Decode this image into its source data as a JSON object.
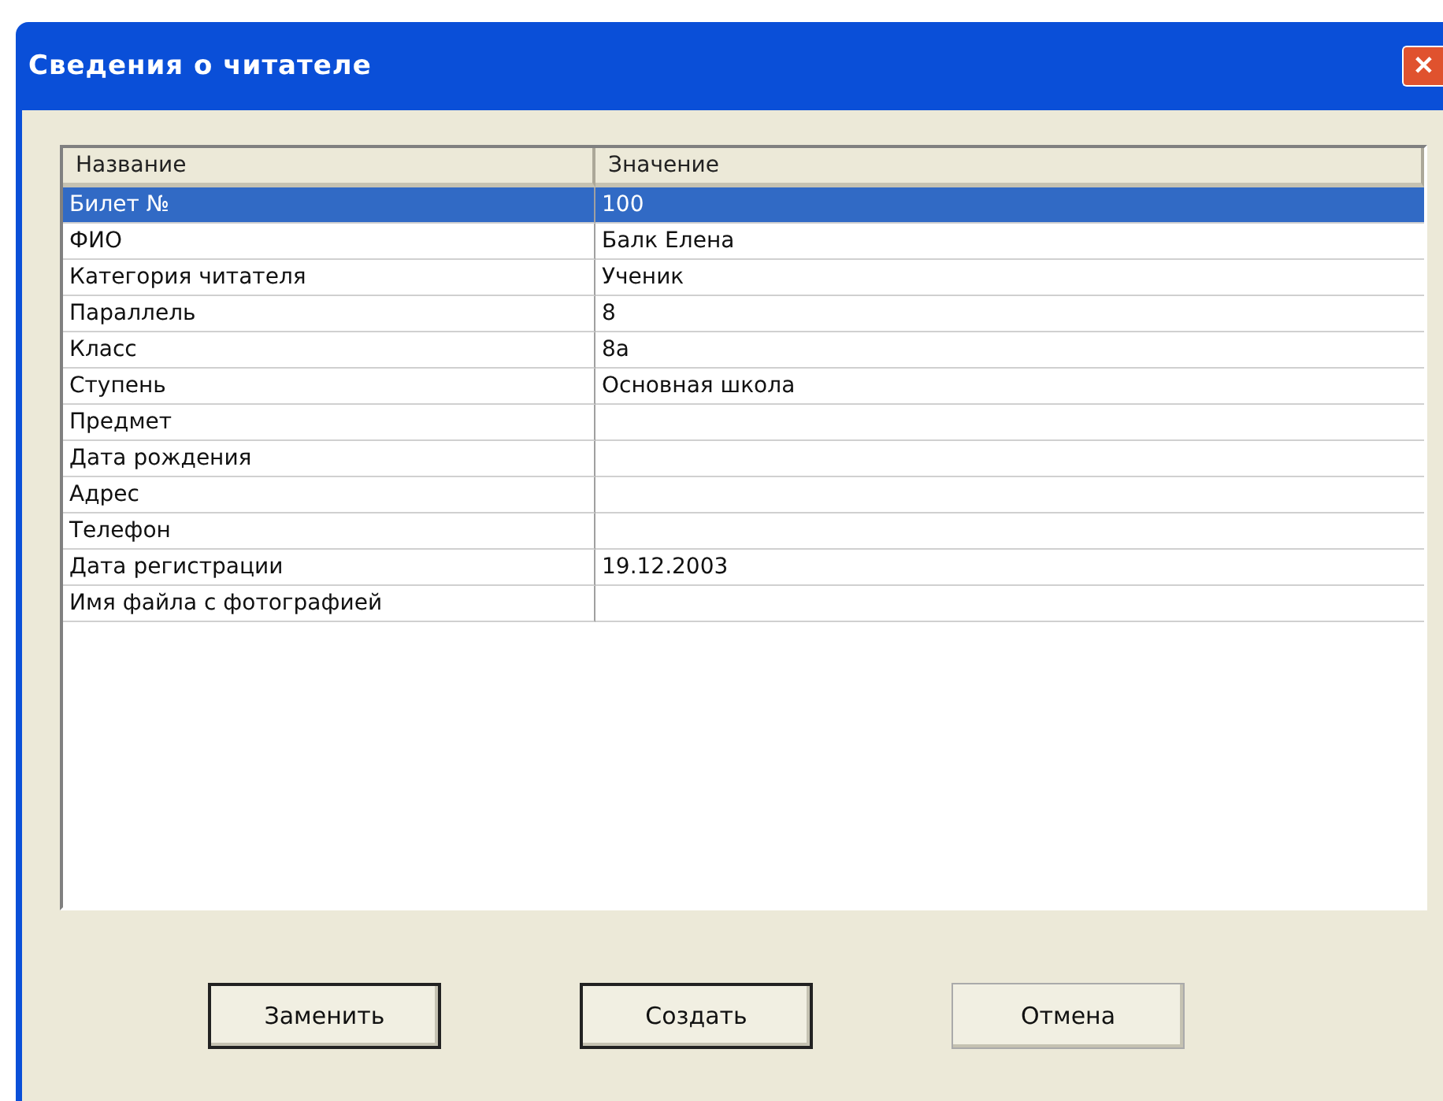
{
  "window": {
    "title": "Сведения о читателе",
    "close": "✕"
  },
  "table": {
    "columns": [
      "Название",
      "Значение"
    ],
    "rows": [
      {
        "name": "Билет №",
        "value": "100",
        "selected": true
      },
      {
        "name": "ФИО",
        "value": "Балк Елена",
        "selected": false
      },
      {
        "name": "Категория читателя",
        "value": "Ученик",
        "selected": false
      },
      {
        "name": "Параллель",
        "value": "8",
        "selected": false
      },
      {
        "name": "Класс",
        "value": "8а",
        "selected": false
      },
      {
        "name": "Ступень",
        "value": "Основная школа",
        "selected": false
      },
      {
        "name": "Предмет",
        "value": "",
        "selected": false
      },
      {
        "name": "Дата рождения",
        "value": "",
        "selected": false
      },
      {
        "name": "Адрес",
        "value": "",
        "selected": false
      },
      {
        "name": "Телефон",
        "value": "",
        "selected": false
      },
      {
        "name": "Дата регистрации",
        "value": "19.12.2003",
        "selected": false
      },
      {
        "name": "Имя файла с фотографией",
        "value": "",
        "selected": false
      }
    ]
  },
  "buttons": [
    {
      "label": "Заменить",
      "default": true
    },
    {
      "label": "Создать",
      "default": true
    },
    {
      "label": "Отмена",
      "default": false
    }
  ]
}
